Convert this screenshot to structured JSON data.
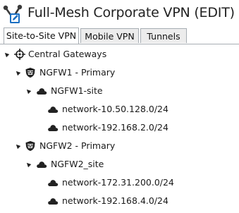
{
  "window": {
    "title": "Full-Mesh Corporate VPN (EDIT)"
  },
  "tabs": [
    {
      "label": "Site-to-Site VPN",
      "active": true
    },
    {
      "label": "Mobile VPN",
      "active": false
    },
    {
      "label": "Tunnels",
      "active": false
    }
  ],
  "tree": {
    "root": {
      "label": "Central Gateways",
      "icon": "gateway-target-icon"
    },
    "gateways": [
      {
        "label": "NGFW1 - Primary",
        "icon": "firewall-shield-icon",
        "site": {
          "label": "NGFW1-site",
          "icon": "cloud-icon",
          "networks": [
            "network-10.50.128.0/24",
            "network-192.168.2.0/24"
          ]
        }
      },
      {
        "label": "NGFW2 - Primary",
        "icon": "firewall-shield-icon",
        "site": {
          "label": "NGFW2_site",
          "icon": "cloud-icon",
          "networks": [
            "network-172.31.200.0/24",
            "network-192.168.4.0/24"
          ]
        }
      }
    ]
  },
  "colors": {
    "accent": "#1a6fc2",
    "tab_border": "#a7adb3",
    "tab_inactive_bg": "#ececec"
  }
}
